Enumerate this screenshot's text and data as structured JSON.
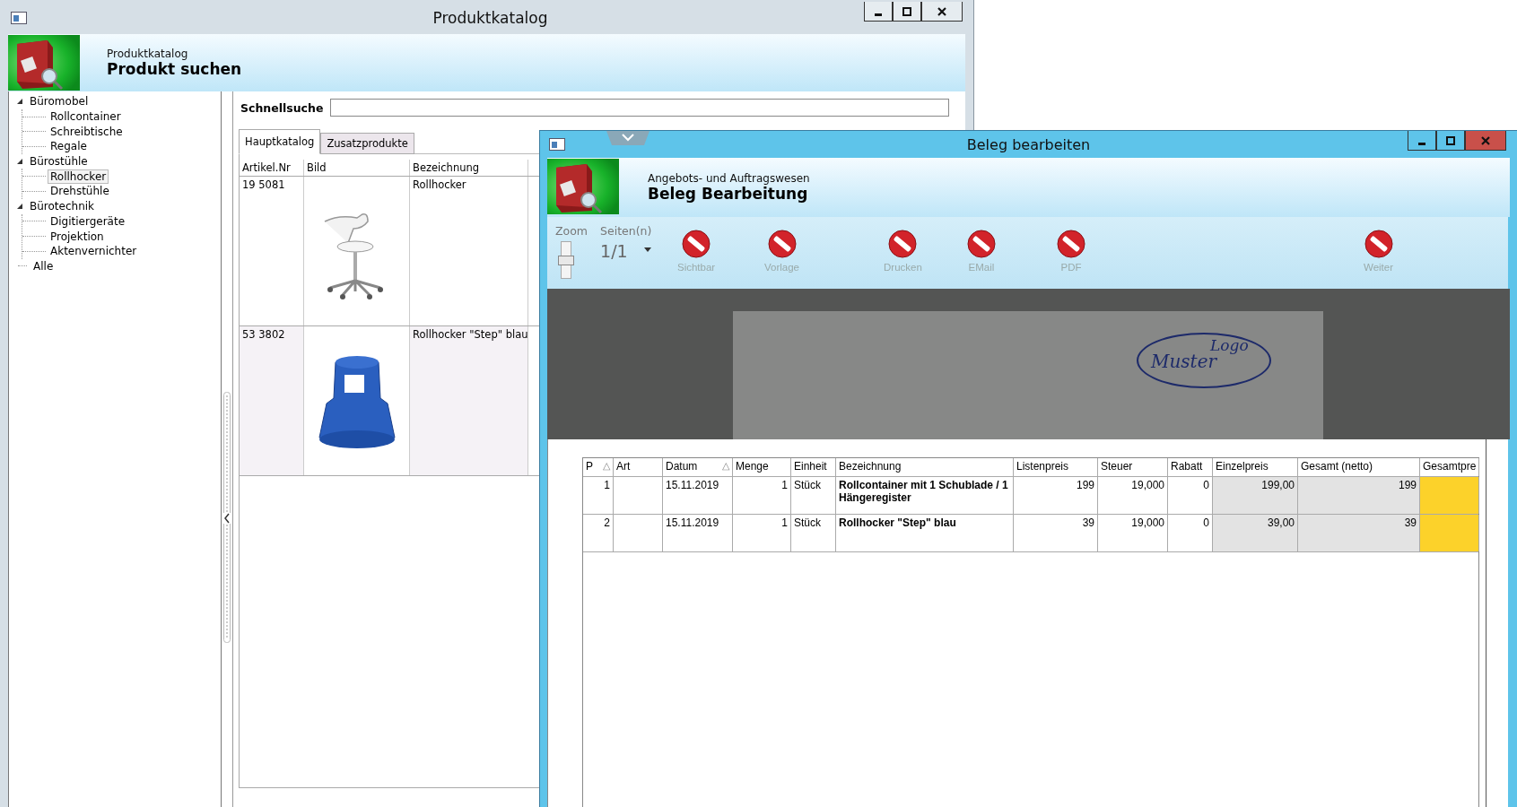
{
  "catalog_window": {
    "title": "Produktkatalog",
    "header": {
      "subtitle": "Produktkatalog",
      "heading": "Produkt suchen"
    },
    "tree": [
      {
        "label": "Büromobel",
        "expanded": true,
        "selected": false,
        "children": [
          {
            "label": "Rollcontainer",
            "selected": false
          },
          {
            "label": "Schreibtische",
            "selected": false
          },
          {
            "label": "Regale",
            "selected": false
          }
        ]
      },
      {
        "label": "Bürostühle",
        "expanded": true,
        "selected": false,
        "children": [
          {
            "label": "Rollhocker",
            "selected": true
          },
          {
            "label": "Drehstühle",
            "selected": false
          }
        ]
      },
      {
        "label": "Bürotechnik",
        "expanded": true,
        "selected": false,
        "children": [
          {
            "label": "Digitiergeräte",
            "selected": false
          },
          {
            "label": "Projektion",
            "selected": false
          },
          {
            "label": "Aktenvernichter",
            "selected": false
          }
        ]
      },
      {
        "label": "Alle",
        "selected": false
      }
    ],
    "search": {
      "label": "Schnellsuche"
    },
    "tabs": [
      {
        "label": "Hauptkatalog",
        "selected": true
      },
      {
        "label": "Zusatzprodukte",
        "selected": false
      }
    ],
    "table": {
      "columns": [
        "Artikel.Nr",
        "Bild",
        "Bezeichnung"
      ],
      "rows": [
        {
          "artikel": "19 5081",
          "kind": "chair",
          "bezeichnung": "Rollhocker"
        },
        {
          "artikel": "53 3802",
          "kind": "step-stool",
          "bezeichnung": "Rollhocker \"Step\" blau"
        }
      ]
    }
  },
  "document_window": {
    "title": "Beleg bearbeiten",
    "header": {
      "subtitle": "Angebots- und Auftragswesen",
      "heading": "Beleg Bearbeitung"
    },
    "toolbar": {
      "zoom_label": "Zoom",
      "zoom": {
        "level": 0.5
      },
      "pages_label": "Seiten(n)",
      "pages": "1/1",
      "buttons": [
        {
          "label": "Sichtbar",
          "disabled": true
        },
        {
          "label": "Vorlage",
          "disabled": true
        },
        {
          "label": "Drucken",
          "disabled": true
        },
        {
          "label": "EMail",
          "disabled": true
        },
        {
          "label": "PDF",
          "disabled": true
        },
        {
          "label": "Weiter",
          "disabled": true
        }
      ]
    },
    "preview": {
      "logo_text": [
        "Muster",
        "Logo"
      ]
    },
    "table": {
      "columns": [
        {
          "label": "P",
          "kind": "number",
          "sort": "△"
        },
        {
          "label": "Art",
          "kind": "text"
        },
        {
          "label": "Datum",
          "kind": "text",
          "sort": "△"
        },
        {
          "label": "Menge",
          "kind": "number"
        },
        {
          "label": "Einheit",
          "kind": "text"
        },
        {
          "label": "Bezeichnung",
          "kind": "name"
        },
        {
          "label": "Listenpreis",
          "kind": "number"
        },
        {
          "label": "Steuer",
          "kind": "number"
        },
        {
          "label": "Rabatt",
          "kind": "number"
        },
        {
          "label": "Einzelpreis",
          "kind": "computed"
        },
        {
          "label": "Gesamt (netto)",
          "kind": "computed"
        },
        {
          "label": "Gesamtpre",
          "kind": "total"
        }
      ],
      "rows": [
        {
          "p": "1",
          "datum": "15.11.2019",
          "menge": "1",
          "einheit": "Stück",
          "bezeichnung": "Rollcontainer mit 1 Schublade / 1 Hängeregister",
          "listenpreis": "199",
          "steuer": "19,000",
          "rabatt": "0",
          "einzelpreis": "199,00",
          "gesamt_netto": "199"
        },
        {
          "p": "2",
          "datum": "15.11.2019",
          "menge": "1",
          "einheit": "Stück",
          "bezeichnung": "Rollhocker \"Step\" blau",
          "listenpreis": "39",
          "steuer": "19,000",
          "rabatt": "0",
          "einzelpreis": "39,00",
          "gesamt_netto": "39"
        }
      ]
    }
  }
}
